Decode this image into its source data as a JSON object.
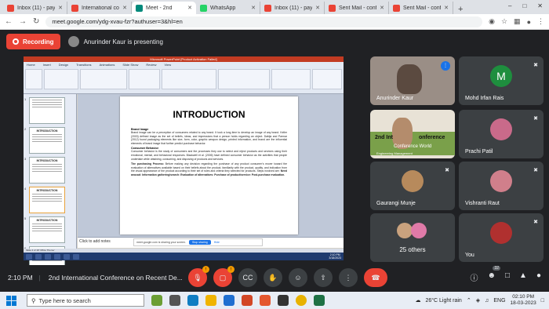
{
  "browser": {
    "tabs": [
      {
        "label": "Inbox (11) - pay",
        "color": "#ea4335",
        "active": false
      },
      {
        "label": "International co",
        "color": "#ea4335",
        "active": false
      },
      {
        "label": "Meet - 2nd",
        "color": "#00897b",
        "active": true
      },
      {
        "label": "WhatsApp",
        "color": "#25d366",
        "active": false
      },
      {
        "label": "Inbox (11) - pay",
        "color": "#ea4335",
        "active": false
      },
      {
        "label": "Sent Mail - conf",
        "color": "#ea4335",
        "active": false
      },
      {
        "label": "Sent Mail - conf",
        "color": "#ea4335",
        "active": false
      }
    ],
    "url": "meet.google.com/ydg-xvau-fzr?authuser=3&hl=en"
  },
  "meet": {
    "recording_label": "Recording",
    "presenting_label": "Anurinder Kaur is presenting",
    "participants": [
      {
        "name": "Anurinder Kaur",
        "type": "video"
      },
      {
        "name": "Mohd Irfan Rais",
        "type": "initial",
        "initial": "M",
        "color": "#1e8e3e"
      },
      {
        "name": "",
        "type": "video-banner",
        "banner_line1": "2nd Int",
        "banner_line2": "Conference World",
        "banner_right": "onference",
        "banner_small": "Engineering Management"
      },
      {
        "name": "Prachi Patil",
        "type": "photo",
        "color": "#c96a8a"
      },
      {
        "name": "Gaurangi Munje",
        "type": "photo",
        "color": "#b78a5c"
      },
      {
        "name": "Vishranti Raut",
        "type": "photo",
        "color": "#d07f8b"
      },
      {
        "name": "25 others",
        "type": "group"
      },
      {
        "name": "You",
        "type": "photo",
        "color": "#b0302f"
      }
    ],
    "time": "2:10 PM",
    "meeting_name": "2nd International Conference on Recent De...",
    "badges": {
      "mic": "!",
      "cam": "!",
      "people": "32"
    }
  },
  "presentation": {
    "slide_title": "INTRODUCTION",
    "brand_image_heading": "Brand Image",
    "brand_image_text": "Brand image can be a perception of consumers related to any brand. It took a long time to develop an image of any brand. Keller (2003) defined image as the set of beliefs, ideas, and impressions that a person holds regarding an object. Dabija and Parmar (2012) found packaging elements like size, form, color, graphic weapon design, printed information, and brand are the influential elements of brand image that further predict purchase behavior.",
    "consumer_heading": "Consumer Behavior",
    "consumer_text": "Consumer behavior is the study of consumers and the processes they use to select and reject products and services using their emotional, mental, and behavioral responses. Blackwell et al. (2006) have defined consumer behavior as the activities that people undertake while obtaining, consuming, and disposing of products and services.",
    "purchasing_heading": "The purchasing Process:",
    "purchasing_text": "Before making any decision regarding the purchase of any product consumer's mover toward the evaluation of alternatives available based on their beliefs about the product, familiarity with the product, quality, and indication from the visual appearance of the product according to their set of rules and criteria they selected for products. Steps involved are:",
    "steps_text": "Need arousal: Information gathering/search: Evaluation of alternatives: Purchase of product/service: Post-purchase evaluation.",
    "notes_placeholder": "Click to add notes",
    "share_text": "meet.google.com is sharing your screen.",
    "stop_sharing": "Stop sharing",
    "hide": "Hide",
    "app_title": "Microsoft PowerPoint [Product Activation Failed]",
    "ribbon_tabs": [
      "Home",
      "Insert",
      "Design",
      "Transitions",
      "Animations",
      "Slide Show",
      "Review",
      "View"
    ],
    "thumbnails": [
      "",
      "INTRODUCTION",
      "INTRODUCTION",
      "INTRODUCTION",
      "INTRODUCTION",
      "LITERATURE REVIEW"
    ],
    "status_text": "Slide 4 of 18   'Office Theme'",
    "clock_time": "2:10 PM",
    "clock_date": "3/18/2023"
  },
  "taskbar": {
    "search_placeholder": "Type here to search",
    "weather": "26°C  Light rain",
    "lang": "ENG",
    "time": "02:10 PM",
    "date": "18-03-2023"
  }
}
